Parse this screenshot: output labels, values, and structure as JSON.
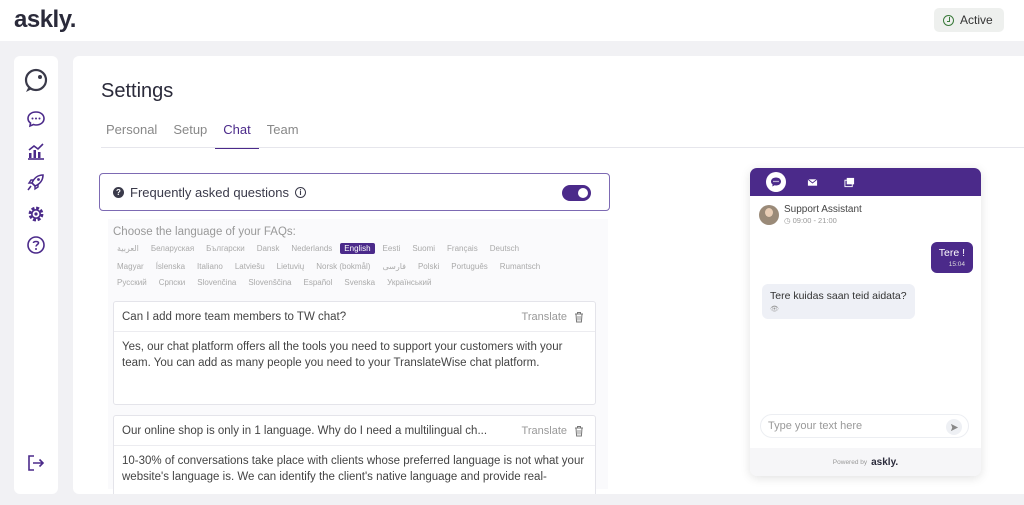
{
  "app": {
    "logo": "askly",
    "logo_dot": ".",
    "status_label": "Active"
  },
  "sidebar": {
    "items": [
      {
        "name": "logo-bubble-icon"
      },
      {
        "name": "chat-icon"
      },
      {
        "name": "stats-icon"
      },
      {
        "name": "rocket-icon"
      },
      {
        "name": "settings-icon"
      },
      {
        "name": "help-icon"
      },
      {
        "name": "logout-icon"
      }
    ]
  },
  "page": {
    "title": "Settings",
    "tabs": [
      {
        "label": "Personal"
      },
      {
        "label": "Setup"
      },
      {
        "label": "Chat"
      },
      {
        "label": "Team"
      }
    ],
    "active_tab": "Chat"
  },
  "faq": {
    "question_mark": "?",
    "title": "Frequently asked questions",
    "info_mark": "i",
    "enabled": true,
    "lang_label": "Choose the language of your FAQs:",
    "languages_row1": [
      "العربية",
      "Беларуская",
      "Български",
      "Dansk",
      "Nederlands",
      "English",
      "Eesti",
      "Suomi",
      "Français",
      "Deutsch"
    ],
    "languages_row2": [
      "Magyar",
      "Íslenska",
      "Italiano",
      "Latviešu",
      "Lietuvių",
      "Norsk (bokmål)",
      "فارسی",
      "Polski",
      "Português",
      "Rumantsch"
    ],
    "languages_row3": [
      "Русский",
      "Српски",
      "Slovenčina",
      "Slovenščina",
      "Español",
      "Svenska",
      "Український"
    ],
    "selected_language": "English",
    "items": [
      {
        "question": "Can I add more team members to TW chat?",
        "translate": "Translate",
        "answer": "Yes, our chat platform offers all the tools you need to support your customers with your team. You can add as many people you need to your TranslateWise chat platform."
      },
      {
        "question": "Our online shop is only in 1 language. Why do I need a multilingual ch...",
        "translate": "Translate",
        "answer": "10-30% of conversations take place with clients whose preferred language is not what your website's language is. We can identify the client's native language and provide real-"
      }
    ]
  },
  "widget": {
    "agent_name": "Support Assistant",
    "agent_hours": "◷ 09:00 - 21:00",
    "messages": [
      {
        "direction": "out",
        "text": "Tere !",
        "time": "15:04"
      },
      {
        "direction": "in",
        "text": "Tere kuidas saan teid aidata?",
        "seen": "👁"
      }
    ],
    "input_placeholder": "Type your text here",
    "powered_by": "Powered by",
    "powered_brand": "askly."
  },
  "colors": {
    "brand": "#4b2a8a",
    "background": "#f1f1f4"
  }
}
